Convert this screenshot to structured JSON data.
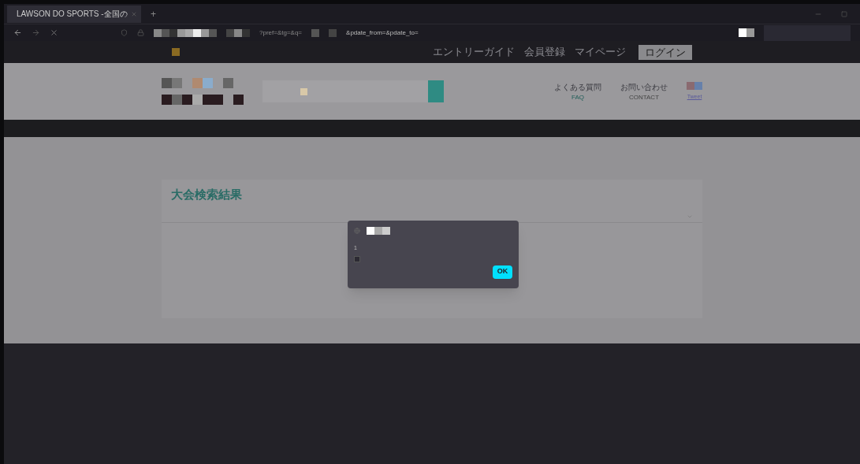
{
  "browser": {
    "tab": {
      "title": "LAWSON DO SPORTS -全国の",
      "selected": true
    },
    "new_tab": "+",
    "url": "?pref=&tg=&q=",
    "url_tail": "&pdate_from=&pdate_to="
  },
  "site_header": {
    "top_links": [
      "エントリーガイド",
      "会員登録",
      "マイページ"
    ],
    "login": "ログイン",
    "nav": [
      {
        "label": "よくある質問",
        "sub": "FAQ"
      },
      {
        "label": "お問い合わせ",
        "sub": "CONTACT"
      }
    ],
    "tweet": "Tweet"
  },
  "page_title": "大会検索結果",
  "dialog": {
    "message": "1",
    "checkbox": {
      "checked": false
    },
    "button": "OK"
  }
}
